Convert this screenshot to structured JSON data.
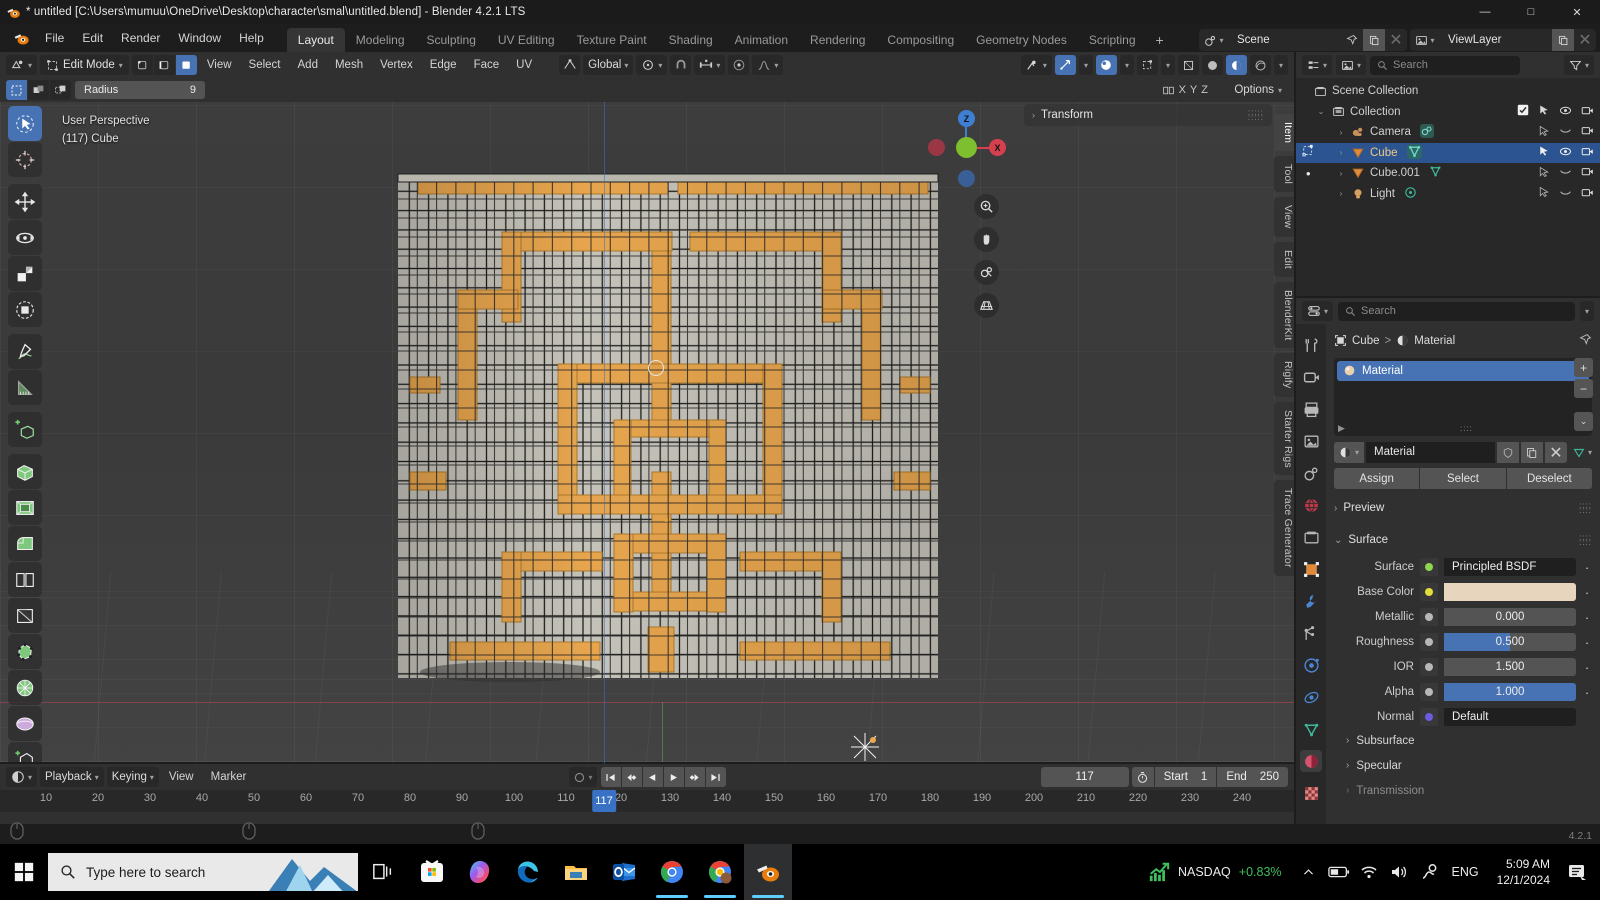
{
  "window": {
    "title": "* untitled [C:\\Users\\mumuu\\OneDrive\\Desktop\\character\\smal\\untitled.blend] - Blender 4.2.1 LTS",
    "app_icon": "blender-logo-icon",
    "minimize": "—",
    "maximize": "□",
    "close": "✕"
  },
  "topbar": {
    "menus": [
      "File",
      "Edit",
      "Render",
      "Window",
      "Help"
    ],
    "workspaces": [
      {
        "label": "Layout",
        "active": true
      },
      {
        "label": "Modeling",
        "active": false
      },
      {
        "label": "Sculpting",
        "active": false
      },
      {
        "label": "UV Editing",
        "active": false
      },
      {
        "label": "Texture Paint",
        "active": false
      },
      {
        "label": "Shading",
        "active": false
      },
      {
        "label": "Animation",
        "active": false
      },
      {
        "label": "Rendering",
        "active": false
      },
      {
        "label": "Compositing",
        "active": false
      },
      {
        "label": "Geometry Nodes",
        "active": false
      },
      {
        "label": "Scripting",
        "active": false
      }
    ],
    "add_workspace": "+",
    "scene_label": "Scene",
    "viewlayer_label": "ViewLayer"
  },
  "viewport_header": {
    "editor_type_icon": "editor-type-icon",
    "mode": "Edit Mode",
    "select_modes": [
      "vertex-select-icon",
      "edge-select-icon",
      "face-select-icon"
    ],
    "active_select_mode_index": 2,
    "menus": [
      "View",
      "Select",
      "Add",
      "Mesh",
      "Vertex",
      "Edge",
      "Face",
      "UV"
    ],
    "transform_orientation": "Global",
    "snap_icon": "magnet-icon",
    "proportional_icon": "proportional-edit-icon",
    "shading_modes": [
      "wireframe-icon",
      "solid-icon",
      "material-preview-icon",
      "rendered-icon"
    ],
    "active_shading_index": 2
  },
  "tool_settings": {
    "falloff_icons": [
      "circle-select-icon",
      "box-icon",
      "lasso-icon"
    ],
    "radius_label": "Radius",
    "radius_value": "9",
    "options_label": "Options",
    "xyz_labels": [
      "X",
      "Y",
      "Z"
    ]
  },
  "viewport": {
    "overlay_line1": "User Perspective",
    "overlay_line2": "(117) Cube",
    "gizmo_axes": [
      {
        "label": "Z",
        "color": "#3e7fd4"
      },
      {
        "label": "X",
        "color": "#d4404e"
      },
      {
        "label": "Y",
        "color": "#7dbf2f"
      }
    ],
    "nav_buttons": [
      "zoom-icon",
      "pan-hand-icon",
      "camera-view-icon",
      "toggle-perspective-icon"
    ],
    "tools": [
      {
        "name": "tweak-select-tool",
        "active": true
      },
      {
        "name": "cursor-tool",
        "active": false
      },
      {
        "name": "move-tool",
        "active": false
      },
      {
        "name": "rotate-tool",
        "active": false
      },
      {
        "name": "scale-tool",
        "active": false
      },
      {
        "name": "transform-tool",
        "active": false
      },
      {
        "name": "annotate-tool",
        "active": false
      },
      {
        "name": "measure-tool",
        "active": false
      },
      {
        "name": "add-cube-tool",
        "active": false
      },
      {
        "name": "extrude-region-tool",
        "active": false
      },
      {
        "name": "inset-faces-tool",
        "active": false
      },
      {
        "name": "bevel-tool",
        "active": false
      },
      {
        "name": "loop-cut-tool",
        "active": false
      },
      {
        "name": "knife-tool",
        "active": false
      },
      {
        "name": "poly-build-tool",
        "active": false
      },
      {
        "name": "spin-tool",
        "active": false
      },
      {
        "name": "smooth-tool",
        "active": false
      },
      {
        "name": "shrink-fatten-tool",
        "active": false
      }
    ],
    "sidebar_panel_title": "Transform",
    "sidebar_tabs": [
      "Item",
      "Tool",
      "View",
      "Edit",
      "BlenderKit",
      "Rigify",
      "Starter Rigs",
      "Trace Generator"
    ],
    "active_sidebar_tab": "Item",
    "mesh_face_color": "#c9c6bd",
    "mesh_selected_color": "#eba84f",
    "mesh_edge_color": "#1e1e1e"
  },
  "outliner": {
    "display_mode_icon": "outliner-display-mode-icon",
    "filter_icon": "filter-icon",
    "search_placeholder": "Search",
    "rows": [
      {
        "label": "Scene Collection",
        "icon": "scene-collection-icon",
        "indent": 0,
        "selected": false,
        "has_disclosure": false,
        "checkbox": false,
        "restrict": []
      },
      {
        "label": "Collection",
        "icon": "collection-icon",
        "indent": 1,
        "selected": false,
        "has_disclosure": true,
        "expanded": true,
        "checkbox": true,
        "restrict": [
          "selectable-arrow-icon",
          "hide-eye-icon",
          "disable-render-camera-icon"
        ]
      },
      {
        "label": "Camera",
        "icon": "camera-data-icon",
        "indent": 2,
        "selected": false,
        "has_disclosure": true,
        "checkbox": false,
        "restrict": [
          "selectable-arrow-icon",
          "hidden-eye-icon",
          "disable-render-camera-icon"
        ]
      },
      {
        "label": "Cube",
        "icon": "mesh-data-icon",
        "indent": 2,
        "selected": true,
        "has_disclosure": true,
        "checkbox": false,
        "restrict": [
          "selectable-arrow-icon",
          "hide-eye-icon",
          "disable-render-camera-icon"
        ]
      },
      {
        "label": "Cube.001",
        "icon": "mesh-data-icon",
        "indent": 2,
        "selected": false,
        "has_disclosure": true,
        "checkbox": false,
        "restrict": [
          "selectable-arrow-icon",
          "hidden-eye-icon",
          "disable-render-camera-icon"
        ]
      },
      {
        "label": "Light",
        "icon": "light-data-icon",
        "indent": 2,
        "selected": false,
        "has_disclosure": true,
        "checkbox": false,
        "restrict": [
          "selectable-arrow-icon",
          "hidden-eye-icon",
          "disable-render-camera-icon"
        ]
      }
    ]
  },
  "properties": {
    "search_placeholder": "Search",
    "tabs": [
      {
        "name": "tool-tab",
        "icon": "tool-icon",
        "active": false
      },
      {
        "name": "render-tab",
        "icon": "render-camera-icon",
        "active": false
      },
      {
        "name": "output-tab",
        "icon": "printer-icon",
        "active": false
      },
      {
        "name": "view-layer-tab",
        "icon": "images-icon",
        "active": false
      },
      {
        "name": "scene-tab",
        "icon": "scene-icon",
        "active": false
      },
      {
        "name": "world-tab",
        "icon": "world-globe-icon",
        "active": false
      },
      {
        "name": "collection-tab",
        "icon": "collection-properties-icon",
        "active": false
      },
      {
        "name": "object-tab",
        "icon": "object-square-icon",
        "active": false
      },
      {
        "name": "modifiers-tab",
        "icon": "wrench-icon",
        "active": false
      },
      {
        "name": "particles-tab",
        "icon": "particles-icon",
        "active": false
      },
      {
        "name": "physics-tab",
        "icon": "physics-orbit-icon",
        "active": false
      },
      {
        "name": "constraints-tab",
        "icon": "constraints-icon",
        "active": false
      },
      {
        "name": "data-tab",
        "icon": "mesh-data-triangle-icon",
        "active": false
      },
      {
        "name": "material-tab",
        "icon": "material-sphere-icon",
        "active": true
      },
      {
        "name": "texture-tab",
        "icon": "checker-texture-icon",
        "active": false
      }
    ],
    "breadcrumb": [
      {
        "label": "Cube",
        "icon": "object-square-icon"
      },
      {
        "label": "Material",
        "icon": "material-sphere-icon"
      }
    ],
    "breadcrumb_separator": ">",
    "pin_icon": "pin-icon",
    "slot_list": [
      {
        "label": "Material",
        "selected": true,
        "icon": "material-preview-ball-icon"
      }
    ],
    "slot_buttons": [
      "+",
      "−",
      "⌄"
    ],
    "material_datablock": {
      "browse_icon": "browse-material-icon",
      "name": "Material",
      "buttons": [
        "shield-fake-user-icon",
        "duplicate-icon",
        "unlink-x-icon"
      ],
      "node_icon": "nodetree-icon"
    },
    "assign_row": [
      "Assign",
      "Select",
      "Deselect"
    ],
    "preview_panel": "Preview",
    "surface_panel": "Surface",
    "surface_rows": [
      {
        "label": "Surface",
        "value": "Principled BSDF",
        "socket": "#8ed74f",
        "style": "dark"
      },
      {
        "label": "Base Color",
        "value": "",
        "socket": "#e0e038",
        "style": "swatch",
        "swatch_color": "#e8d5bd"
      },
      {
        "label": "Metallic",
        "value": "0.000",
        "socket": "#b8b8b8",
        "style": "slider",
        "fill": 0
      },
      {
        "label": "Roughness",
        "value": "0.500",
        "socket": "#b8b8b8",
        "style": "slider",
        "fill": 50
      },
      {
        "label": "IOR",
        "value": "1.500",
        "socket": "#b8b8b8",
        "style": "slider",
        "fill": 0
      },
      {
        "label": "Alpha",
        "value": "1.000",
        "socket": "#b8b8b8",
        "style": "slider",
        "fill": 100
      },
      {
        "label": "Normal",
        "value": "Default",
        "socket": "#6b5ce0",
        "style": "dark"
      }
    ],
    "subpanels": [
      "Subsurface",
      "Specular",
      "Transmission"
    ],
    "version_badge": "4.2.1"
  },
  "timeline": {
    "editor_icon": "timeline-editor-icon",
    "menus": [
      "Playback",
      "Keying",
      "View",
      "Marker"
    ],
    "auto_key_icon": "record-auto-key-icon",
    "playback_buttons": [
      "jump-to-start-icon",
      "jump-to-keyframe-prev-icon",
      "play-reverse-icon",
      "play-icon",
      "jump-to-keyframe-next-icon",
      "jump-to-end-icon"
    ],
    "current_frame": "117",
    "frame_clock_icon": "use-preview-range-icon",
    "start_label": "Start",
    "start_value": "1",
    "end_label": "End",
    "end_value": "250",
    "ruler_ticks": [
      10,
      20,
      30,
      40,
      50,
      60,
      70,
      80,
      90,
      100,
      110,
      120,
      130,
      140,
      150,
      160,
      170,
      180,
      190,
      200,
      210,
      220,
      230,
      240
    ],
    "playhead_frame": "117"
  },
  "status_bar": {
    "version": "4.2.1"
  },
  "taskbar": {
    "start_icon": "windows-start-icon",
    "search_placeholder": "Type here to search",
    "search_icon": "search-icon",
    "task_view_icon": "task-view-icon",
    "apps": [
      {
        "name": "microsoft-store-icon",
        "active": false,
        "running": false
      },
      {
        "name": "copilot-icon",
        "active": false,
        "running": false
      },
      {
        "name": "microsoft-edge-icon",
        "active": false,
        "running": false
      },
      {
        "name": "file-explorer-icon",
        "active": false,
        "running": false
      },
      {
        "name": "outlook-icon",
        "active": false,
        "running": false
      },
      {
        "name": "google-chrome-icon",
        "active": false,
        "running": true
      },
      {
        "name": "google-chrome-profile-icon",
        "active": false,
        "running": true
      },
      {
        "name": "blender-icon",
        "active": true,
        "running": true
      }
    ],
    "tray": {
      "stock_icon": "stock-trend-icon",
      "stock_name": "NASDAQ",
      "stock_change": "+0.83%",
      "stock_change_color": "#3fbf5f",
      "chevron_icon": "show-hidden-icons-chevron",
      "battery_icon": "battery-icon",
      "wifi_icon": "wifi-icon",
      "volume_icon": "volume-icon",
      "pen_icon": "windows-ink-icon",
      "language": "ENG",
      "time": "5:09 AM",
      "date": "12/1/2024",
      "notification_icon": "notification-center-icon"
    }
  }
}
